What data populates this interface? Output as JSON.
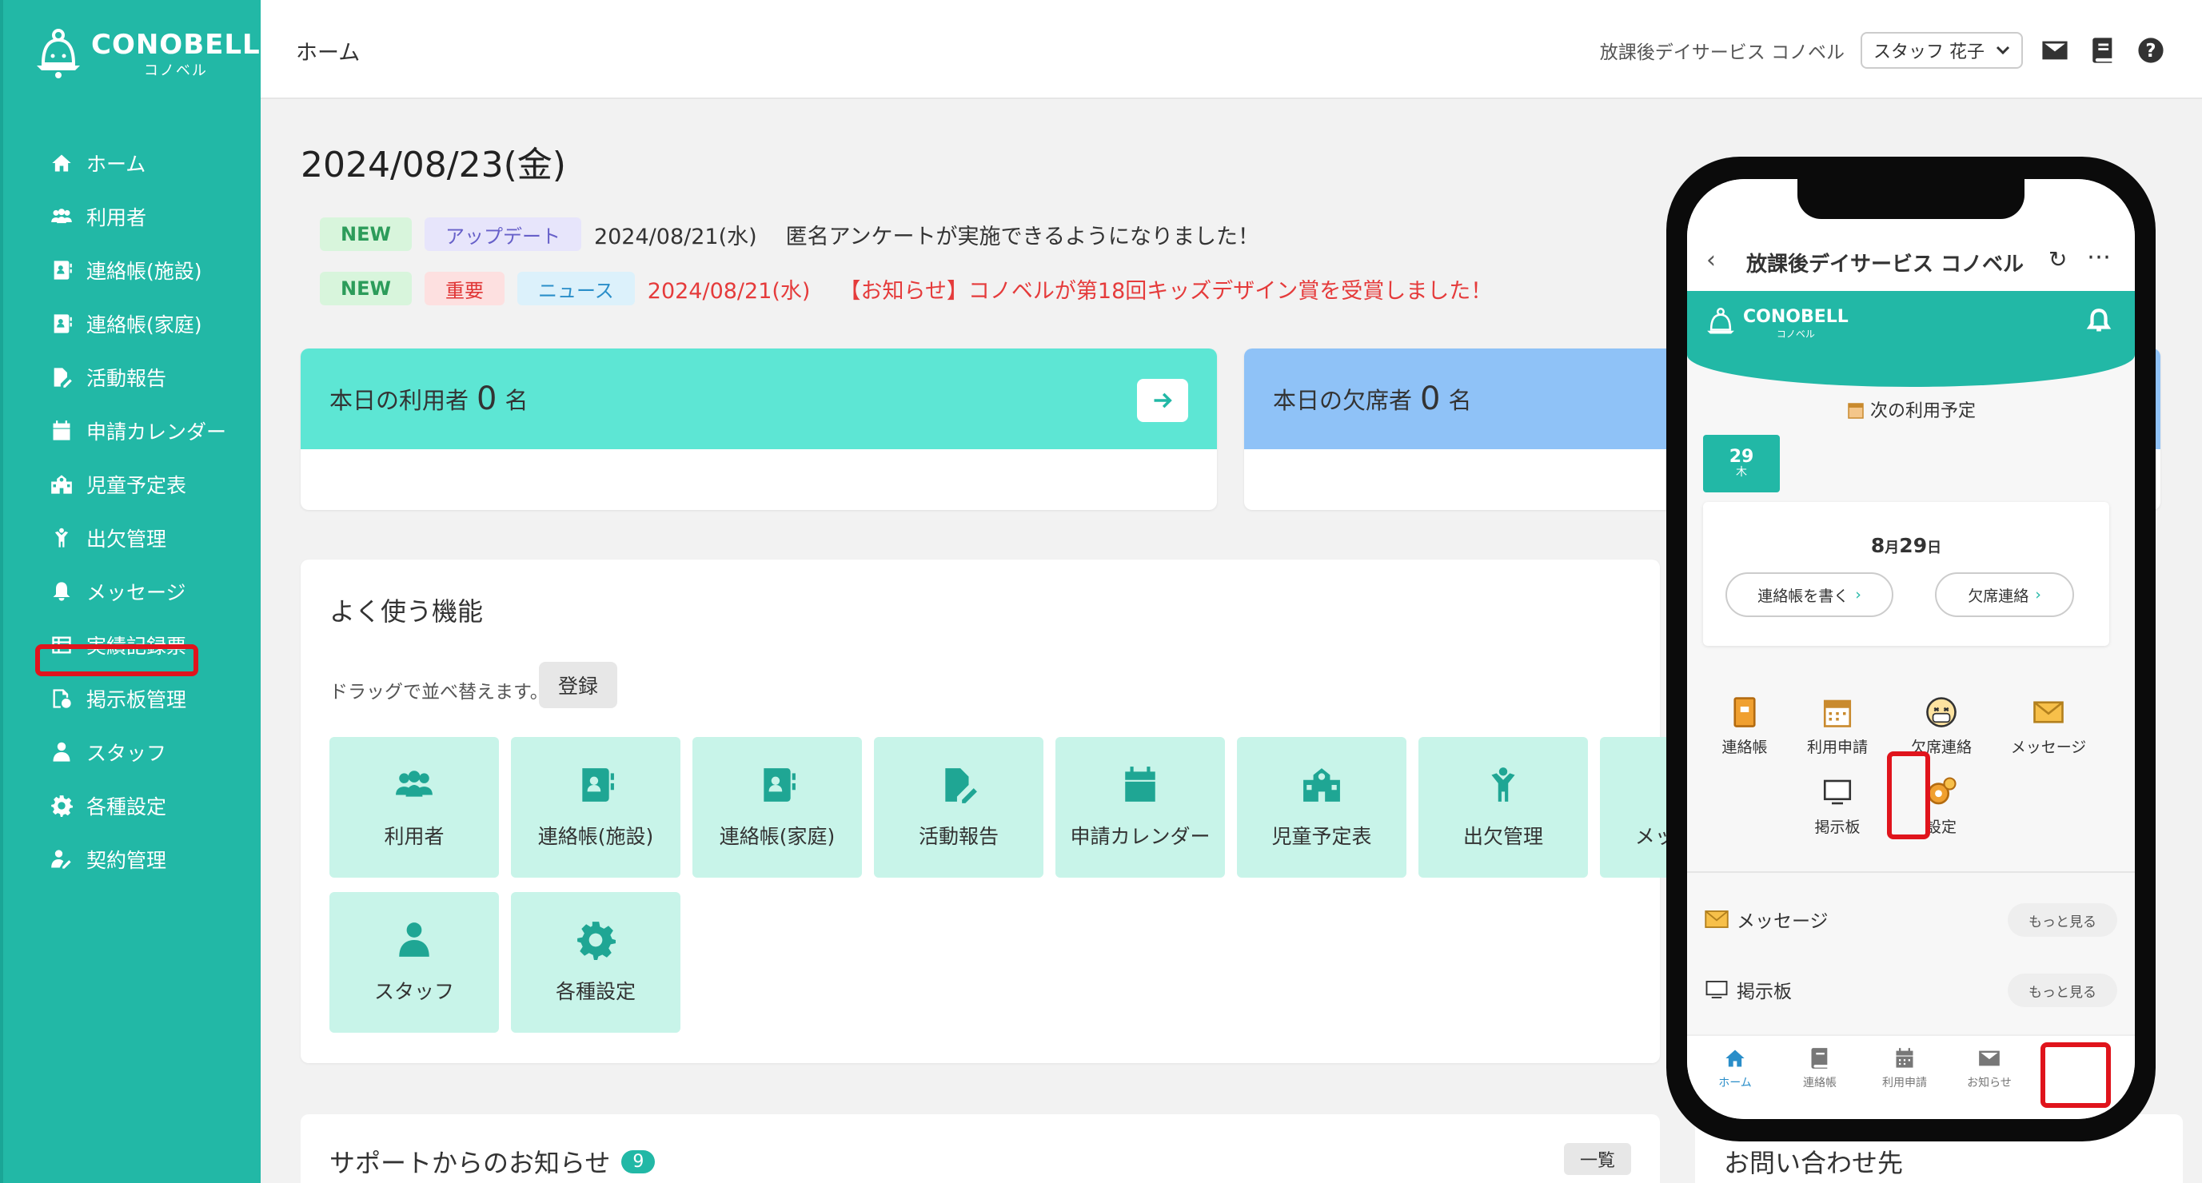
{
  "sidebar": {
    "logo_main": "CONOBELL",
    "logo_sub": "コノベル",
    "items": [
      {
        "label": "ホーム",
        "icon": "home-icon"
      },
      {
        "label": "利用者",
        "icon": "users-icon"
      },
      {
        "label": "連絡帳(施設)",
        "icon": "contact-book-icon"
      },
      {
        "label": "連絡帳(家庭)",
        "icon": "contact-book-icon"
      },
      {
        "label": "活動報告",
        "icon": "report-edit-icon"
      },
      {
        "label": "申請カレンダー",
        "icon": "calendar-icon"
      },
      {
        "label": "児童予定表",
        "icon": "school-icon"
      },
      {
        "label": "出欠管理",
        "icon": "child-icon"
      },
      {
        "label": "メッセージ",
        "icon": "bell-icon"
      },
      {
        "label": "実績記録票",
        "icon": "table-icon"
      },
      {
        "label": "掲示板管理",
        "icon": "board-icon"
      },
      {
        "label": "スタッフ",
        "icon": "staff-icon"
      },
      {
        "label": "各種設定",
        "icon": "gear-icon"
      },
      {
        "label": "契約管理",
        "icon": "contract-icon"
      }
    ]
  },
  "topbar": {
    "title": "ホーム",
    "facility": "放課後デイサービス コノベル",
    "user": "スタッフ 花子"
  },
  "date": "2024/08/23(金)",
  "notices": [
    {
      "badges": [
        {
          "text": "NEW",
          "kind": "new"
        },
        {
          "text": "アップデート",
          "kind": "update"
        }
      ],
      "date": "2024/08/21(水)",
      "text": "匿名アンケートが実施できるようになりました！",
      "red": false
    },
    {
      "badges": [
        {
          "text": "NEW",
          "kind": "new"
        },
        {
          "text": "重要",
          "kind": "important"
        },
        {
          "text": "ニュース",
          "kind": "news"
        }
      ],
      "date": "2024/08/21(水)",
      "text": "【お知らせ】コノベルが第18回キッズデザイン賞を受賞しました！",
      "red": true
    }
  ],
  "stats": {
    "users": {
      "label": "本日の利用者",
      "count": "0",
      "unit": "名",
      "color": "#5de6d4"
    },
    "absent": {
      "label": "本日の欠席者",
      "count": "0",
      "unit": "名",
      "color": "#8fc2f7"
    }
  },
  "functions": {
    "title": "よく使う機能",
    "drag_note": "ドラッグで並べ替えます。",
    "register": "登録",
    "tiles": [
      {
        "label": "利用者",
        "icon": "users-icon"
      },
      {
        "label": "連絡帳(施設)",
        "icon": "contact-book-icon"
      },
      {
        "label": "連絡帳(家庭)",
        "icon": "contact-book-icon"
      },
      {
        "label": "活動報告",
        "icon": "report-edit-icon"
      },
      {
        "label": "申請カレンダー",
        "icon": "calendar-icon"
      },
      {
        "label": "児童予定表",
        "icon": "school-icon"
      },
      {
        "label": "出欠管理",
        "icon": "child-icon"
      },
      {
        "label": "メッセージ",
        "icon": "bell-icon"
      },
      {
        "label": "スタッフ",
        "icon": "staff-icon"
      },
      {
        "label": "各種設定",
        "icon": "gear-icon"
      }
    ]
  },
  "support": {
    "title": "サポートからのお知らせ",
    "count": "9",
    "list": "一覧"
  },
  "inquiry": {
    "title": "お問い合わせ先"
  },
  "phone": {
    "back": "‹",
    "title": "放課後デイサービス コノベル",
    "logo_main": "CONOBELL",
    "logo_sub": "コノベル",
    "next_label": "次の利用予定",
    "badge_day": "29",
    "badge_weekday": "木",
    "card_date_month": "8",
    "card_date_month_unit": "月",
    "card_date_day": "29",
    "card_date_day_unit": "日",
    "write_contact": "連絡帳を書く",
    "absent_contact": "欠席連絡",
    "funcs": [
      "連絡帳",
      "利用申請",
      "欠席連絡",
      "メッセージ",
      "掲示板",
      "設定"
    ],
    "message_label": "メッセージ",
    "board_label": "掲示板",
    "see_more": "もっと見る",
    "tabs": [
      "ホーム",
      "連絡帳",
      "利用申請",
      "お知らせ"
    ]
  },
  "colors": {
    "accent": "#22b8a6",
    "highlight": "#e0141c"
  }
}
